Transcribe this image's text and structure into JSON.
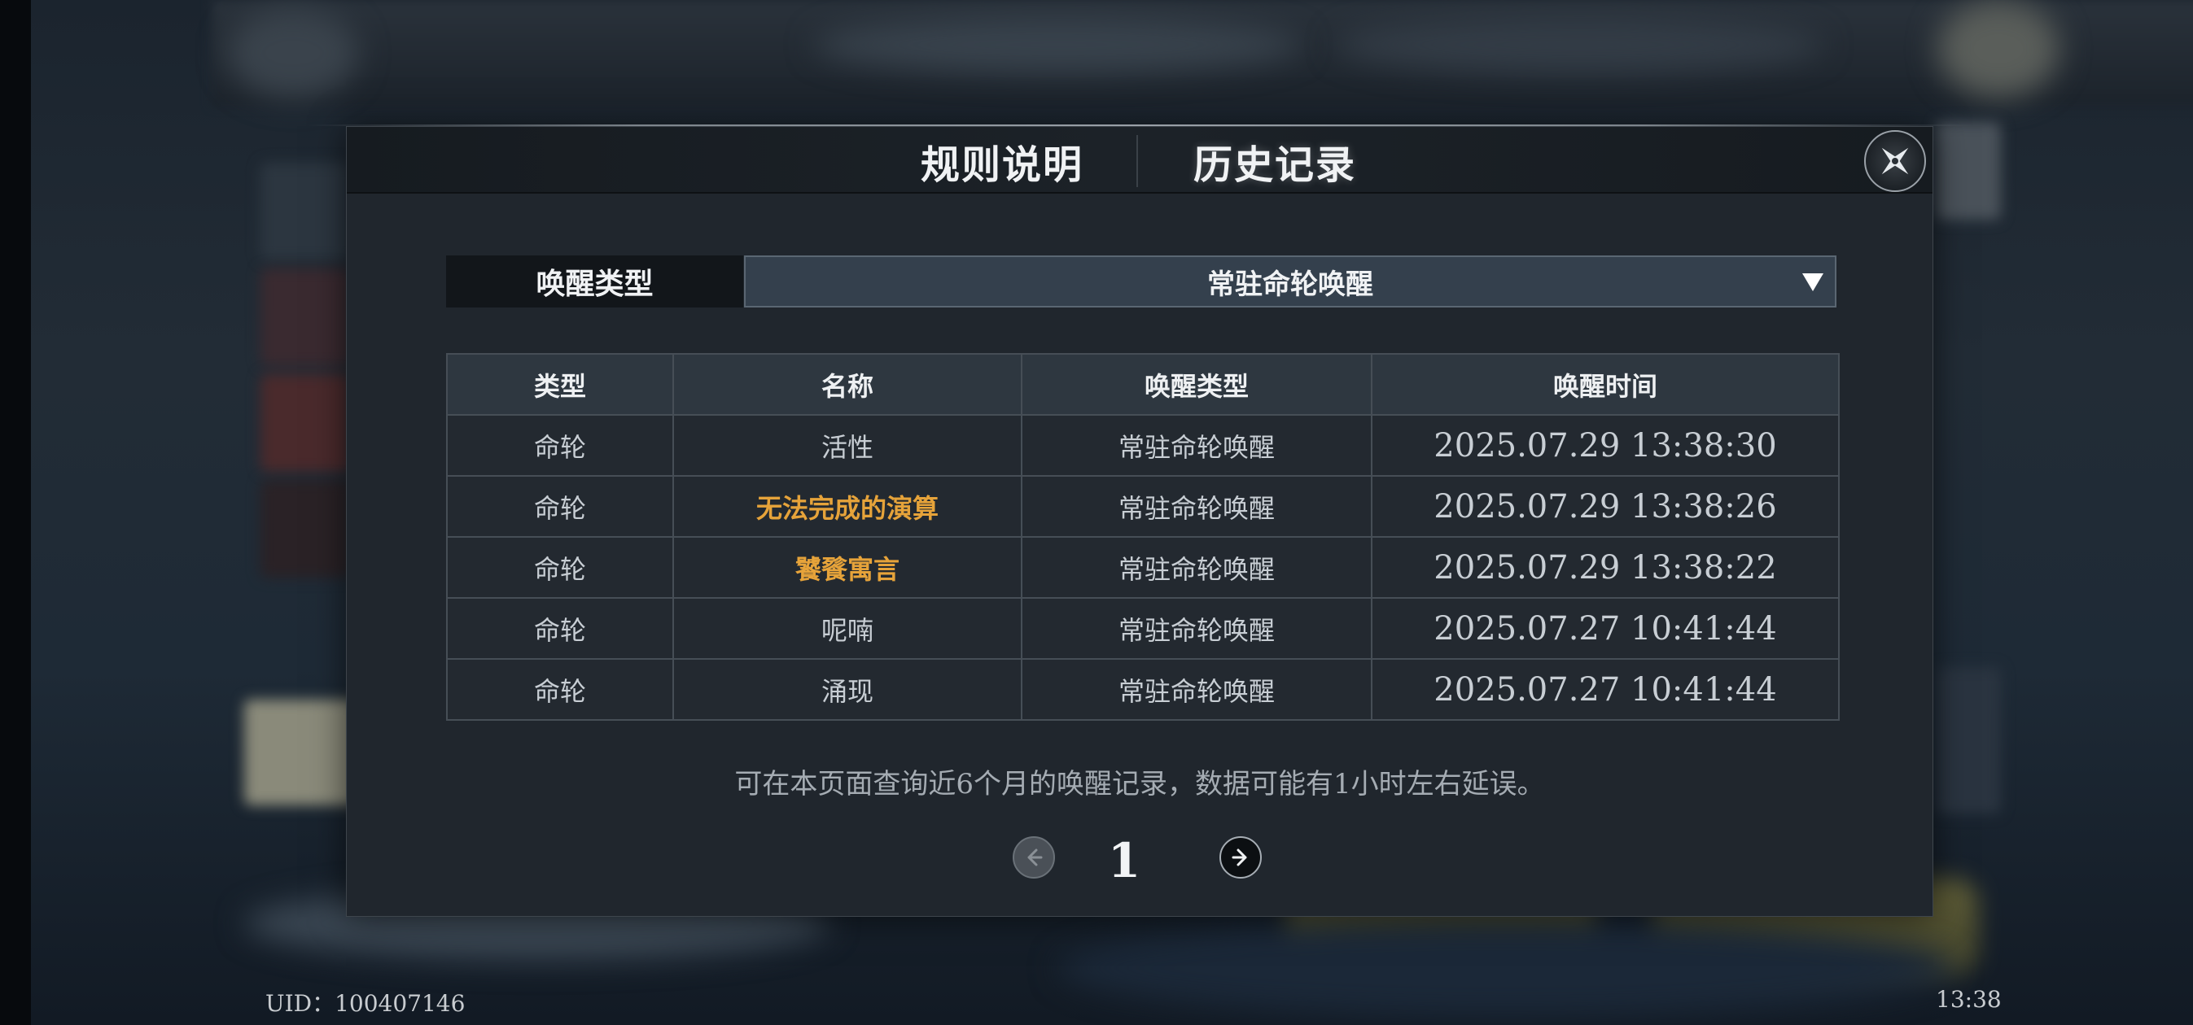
{
  "tabs": [
    {
      "label": "规则说明"
    },
    {
      "label": "历史记录"
    }
  ],
  "filter": {
    "label": "唤醒类型",
    "selected": "常驻命轮唤醒"
  },
  "table": {
    "headers": [
      "类型",
      "名称",
      "唤醒类型",
      "唤醒时间"
    ],
    "rows": [
      {
        "type": "命轮",
        "name": "活性",
        "wake_type": "常驻命轮唤醒",
        "time": "2025.07.29 13:38:30",
        "highlight": false
      },
      {
        "type": "命轮",
        "name": "无法完成的演算",
        "wake_type": "常驻命轮唤醒",
        "time": "2025.07.29 13:38:26",
        "highlight": true
      },
      {
        "type": "命轮",
        "name": "饕餮寓言",
        "wake_type": "常驻命轮唤醒",
        "time": "2025.07.29 13:38:22",
        "highlight": true
      },
      {
        "type": "命轮",
        "name": "呢喃",
        "wake_type": "常驻命轮唤醒",
        "time": "2025.07.27 10:41:44",
        "highlight": false
      },
      {
        "type": "命轮",
        "name": "涌现",
        "wake_type": "常驻命轮唤醒",
        "time": "2025.07.27 10:41:44",
        "highlight": false
      }
    ]
  },
  "note": "可在本页面查询近6个月的唤醒记录，数据可能有1小时左右延误。",
  "pagination": {
    "current_page": "1"
  },
  "footer": {
    "uid": "UID：100407146",
    "clock": "13:38"
  },
  "colors": {
    "highlight": "#e6a33a",
    "modal_bg": "#20262d",
    "select_bg": "#34404d"
  },
  "icons": {
    "close": "close-icon",
    "prev": "arrow-left-icon",
    "next": "arrow-right-icon",
    "dropdown": "triangle-down-icon"
  }
}
